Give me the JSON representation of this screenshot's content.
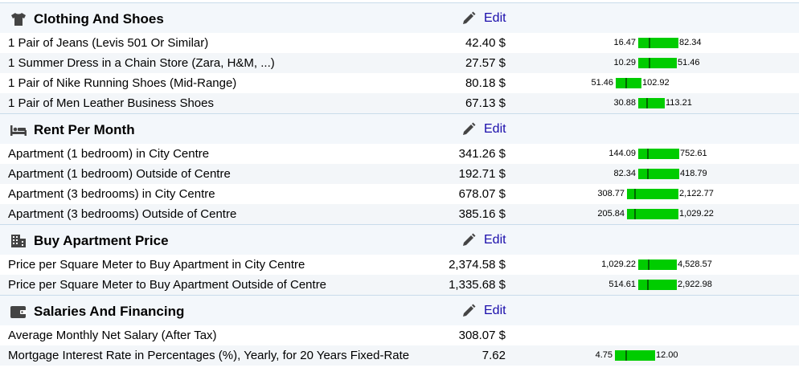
{
  "edit_label": "Edit",
  "colors": {
    "bar": "#00cc00",
    "marker": "#006600",
    "link": "#1a0dab",
    "header_bg": "#f3f7fb"
  },
  "sections": [
    {
      "title": "Clothing And Shoes",
      "icon": "shirt-icon",
      "items": [
        {
          "label": "1 Pair of Jeans (Levis 501 Or Similar)",
          "price": "42.40 $",
          "low": "16.47",
          "high": "82.34",
          "low_val": 16.47,
          "high_val": 82.34,
          "val": 42.4
        },
        {
          "label": "1 Summer Dress in a Chain Store (Zara, H&M, ...)",
          "price": "27.57 $",
          "low": "10.29",
          "high": "51.46",
          "low_val": 10.29,
          "high_val": 51.46,
          "val": 27.57
        },
        {
          "label": "1 Pair of Nike Running Shoes (Mid-Range)",
          "price": "80.18 $",
          "low": "51.46",
          "high": "102.92",
          "low_val": 51.46,
          "high_val": 102.92,
          "val": 80.18
        },
        {
          "label": "1 Pair of Men Leather Business Shoes",
          "price": "67.13 $",
          "low": "30.88",
          "high": "113.21",
          "low_val": 30.88,
          "high_val": 113.21,
          "val": 67.13
        }
      ]
    },
    {
      "title": "Rent Per Month",
      "icon": "bed-icon",
      "items": [
        {
          "label": "Apartment (1 bedroom) in City Centre",
          "price": "341.26 $",
          "low": "144.09",
          "high": "752.61",
          "low_val": 144.09,
          "high_val": 752.61,
          "val": 341.26
        },
        {
          "label": "Apartment (1 bedroom) Outside of Centre",
          "price": "192.71 $",
          "low": "82.34",
          "high": "418.79",
          "low_val": 82.34,
          "high_val": 418.79,
          "val": 192.71
        },
        {
          "label": "Apartment (3 bedrooms) in City Centre",
          "price": "678.07 $",
          "low": "308.77",
          "high": "2,122.77",
          "low_val": 308.77,
          "high_val": 2122.77,
          "val": 678.07
        },
        {
          "label": "Apartment (3 bedrooms) Outside of Centre",
          "price": "385.16 $",
          "low": "205.84",
          "high": "1,029.22",
          "low_val": 205.84,
          "high_val": 1029.22,
          "val": 385.16
        }
      ]
    },
    {
      "title": "Buy Apartment Price",
      "icon": "building-icon",
      "items": [
        {
          "label": "Price per Square Meter to Buy Apartment in City Centre",
          "price": "2,374.58 $",
          "low": "1,029.22",
          "high": "4,528.57",
          "low_val": 1029.22,
          "high_val": 4528.57,
          "val": 2374.58
        },
        {
          "label": "Price per Square Meter to Buy Apartment Outside of Centre",
          "price": "1,335.68 $",
          "low": "514.61",
          "high": "2,922.98",
          "low_val": 514.61,
          "high_val": 2922.98,
          "val": 1335.68
        }
      ]
    },
    {
      "title": "Salaries And Financing",
      "icon": "wallet-icon",
      "items": [
        {
          "label": "Average Monthly Net Salary (After Tax)",
          "price": "308.07 $"
        },
        {
          "label": "Mortgage Interest Rate in Percentages (%), Yearly, for 20 Years Fixed-Rate",
          "price": "7.62",
          "low": "4.75",
          "high": "12.00",
          "low_val": 4.75,
          "high_val": 12.0,
          "val": 7.62
        }
      ]
    }
  ]
}
